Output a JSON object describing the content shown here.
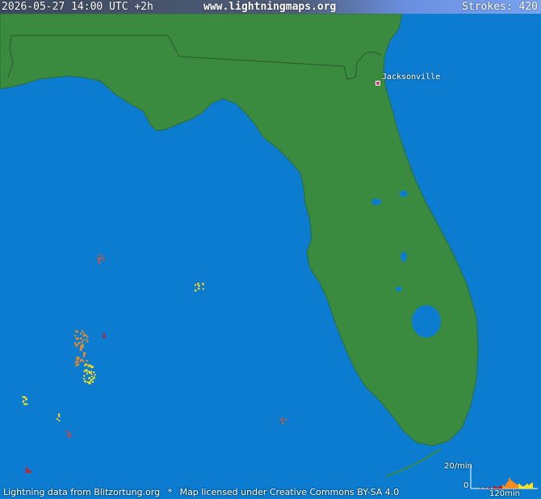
{
  "header": {
    "timestamp": "2026-05-27 14:00 UTC +2h",
    "site": "www.lightningmaps.org",
    "strokes": "Strokes: 420"
  },
  "map": {
    "city": "Jacksonville",
    "land_color": "#3a8a3f",
    "water_color": "#0b7ccf"
  },
  "footer": {
    "credit": "Lightning data from Blitzortung.org",
    "separator": "*",
    "license": "Map licensed under Creative Commons BY-SA 4.0"
  },
  "histogram": {
    "top_label": "20/min",
    "zero_label": "0",
    "span_label": "120min",
    "values": [
      0,
      0,
      0,
      0,
      0,
      1,
      0,
      0,
      1,
      0,
      1,
      1,
      0,
      1,
      2,
      1,
      1,
      2,
      2,
      3,
      2,
      4,
      6,
      9,
      7,
      6,
      5,
      4,
      3,
      4,
      3,
      2,
      2,
      3,
      4,
      3,
      4,
      5
    ]
  }
}
